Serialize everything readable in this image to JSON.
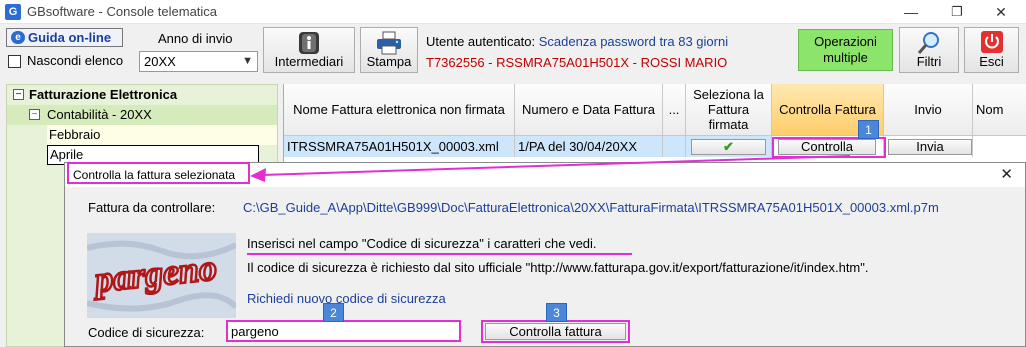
{
  "window": {
    "title": "GBsoftware - Console telematica",
    "app_icon": "G",
    "controls": {
      "minimize": "—",
      "restore": "❐",
      "close": "✕"
    }
  },
  "toolbar": {
    "guide_label": "Guida on-line",
    "hide_list_label": "Nascondi elenco",
    "year_label": "Anno di invio",
    "year_value": "20XX",
    "intermediari_label": "Intermediari",
    "stampa_label": "Stampa",
    "user_prefix": "Utente autenticato:",
    "password_notice": "Scadenza password tra 83 giorni",
    "user_id": "T7362556 - RSSMRA75A01H501X - ROSSI MARIO",
    "operations_label_1": "Operazioni",
    "operations_label_2": "multiple",
    "filters_label": "Filtri",
    "exit_label": "Esci"
  },
  "tree": {
    "root": "Fatturazione Elettronica",
    "child": "Contabilità - 20XX",
    "months": [
      "Febbraio",
      "Aprile"
    ]
  },
  "grid": {
    "headers": [
      "Nome Fattura elettronica non firmata",
      "Numero e Data Fattura",
      "...",
      "Seleziona la Fattura firmata",
      "Controlla Fattura",
      "Invio",
      "Nom"
    ],
    "row": {
      "file": "ITRSSMRA75A01H501X_00003.xml",
      "number": "1/PA del 30/04/20XX",
      "check": "✔",
      "controlla": "Controlla",
      "invia": "Invia"
    }
  },
  "dialog": {
    "title": "Controlla la fattura selezionata",
    "file_label": "Fattura da controllare:",
    "file_path": "C:\\GB_Guide_A\\App\\Ditte\\GB999\\Doc\\FatturaElettronica\\20XX\\FatturaFirmata\\ITRSSMRA75A01H501X_00003.xml.p7m",
    "instruction": "Inserisci nel campo \"Codice di sicurezza\" i caratteri che vedi.",
    "info": "Il codice di sicurezza è richiesto dal sito ufficiale \"http://www.fatturapa.gov.it/export/fatturazione/it/index.htm\".",
    "new_code_link": "Richiedi nuovo codice di sicurezza",
    "security_label": "Codice di sicurezza:",
    "security_value": "pargeno",
    "check_button": "Controlla fattura",
    "captcha_text": "pargeno"
  },
  "callouts": [
    "1",
    "2",
    "3"
  ],
  "colors": {
    "accent": "#e22fd2",
    "badge": "#4c86d8",
    "selected_row": "#cde6fb",
    "tree_bg": "#e8f2d8",
    "ops_button": "#8ce46b",
    "link": "#1b3f9a",
    "user_red": "#c00000"
  }
}
